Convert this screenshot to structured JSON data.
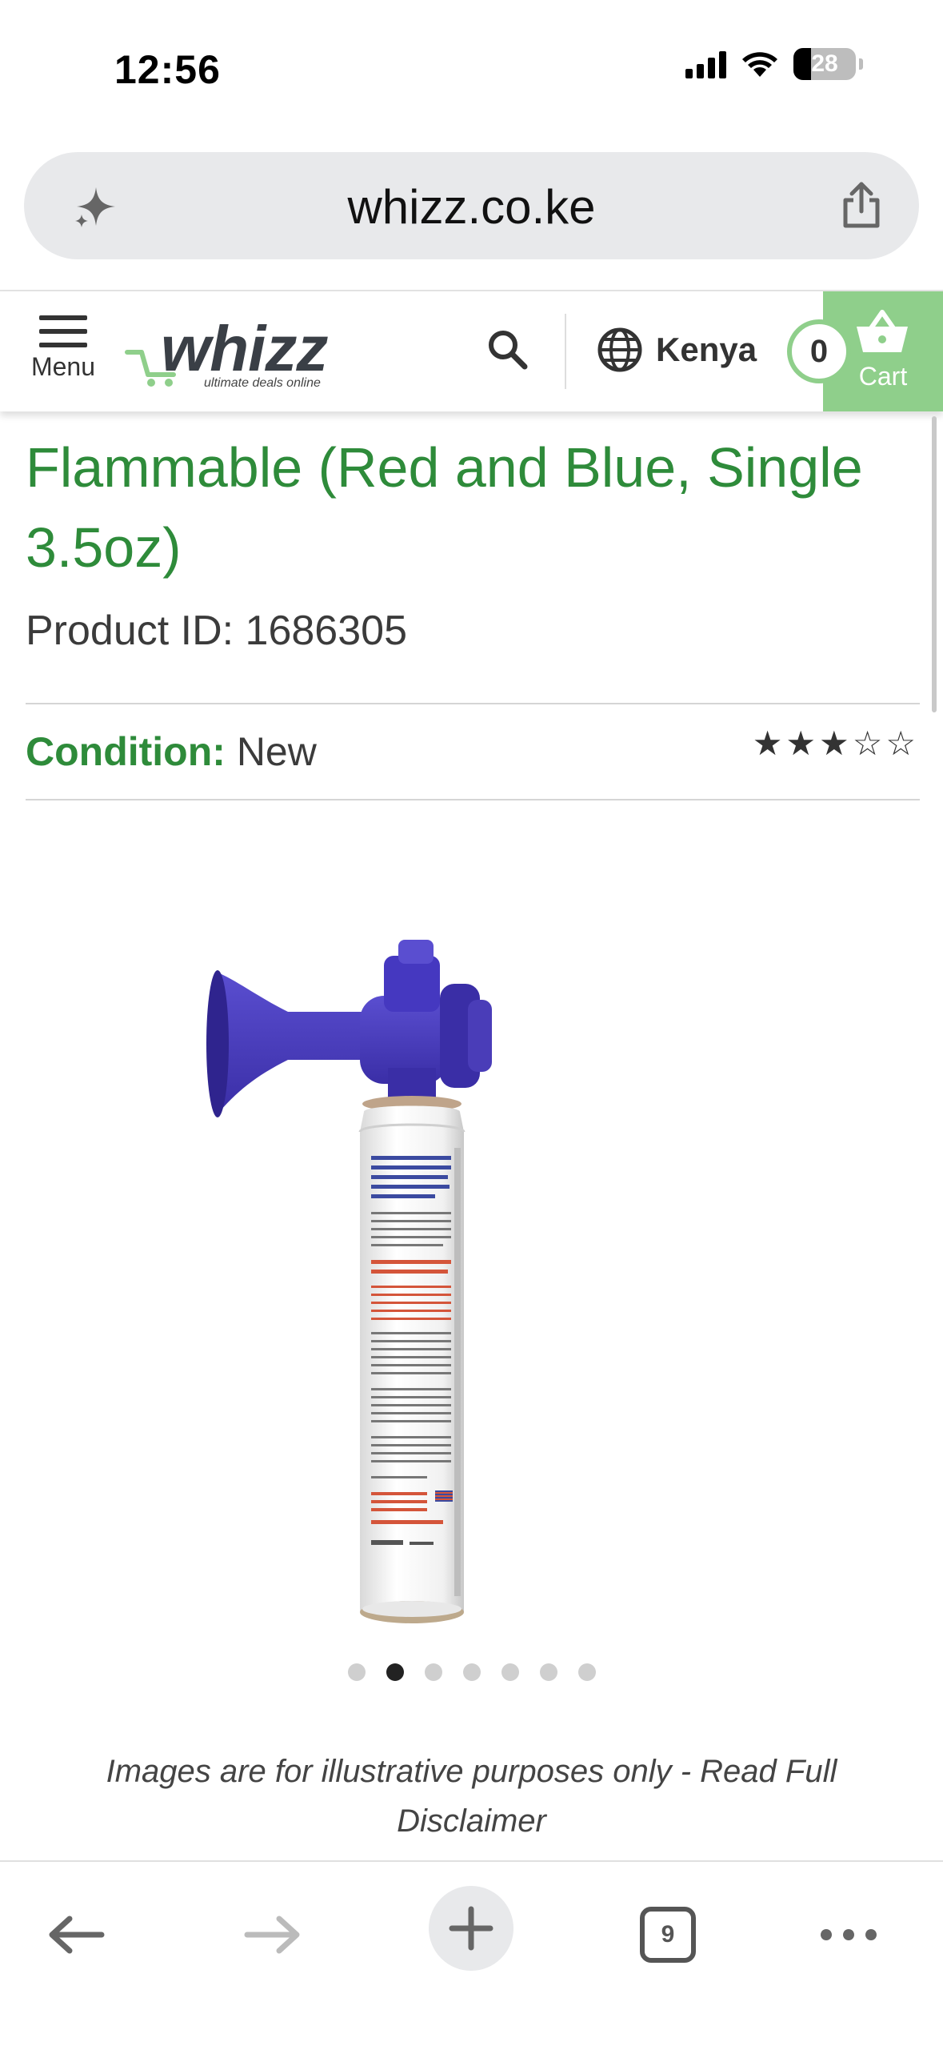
{
  "status_bar": {
    "time": "12:56",
    "battery": "28"
  },
  "browser": {
    "url": "whizz.co.ke",
    "tab_count": "9"
  },
  "header": {
    "menu_label": "Menu",
    "logo_text": "whizz",
    "logo_tagline": "ultimate deals online",
    "country": "Kenya",
    "cart_count": "0",
    "cart_label": "Cart"
  },
  "product": {
    "title": "Flammable (Red and Blue, Single 3.5oz)",
    "product_id": "Product ID: 1686305",
    "condition_label": "Condition:",
    "condition_value": "New",
    "rating": 3,
    "rating_max": 5,
    "image_count": 7,
    "active_image_index": 1,
    "image_alt": "air horn"
  },
  "disclaimer": "Images are for illustrative purposes only - Read Full Disclaimer",
  "colors": {
    "brand_green": "#2e8b3a",
    "cart_green": "#8fcf8b",
    "horn_blue": "#4a3db8"
  }
}
